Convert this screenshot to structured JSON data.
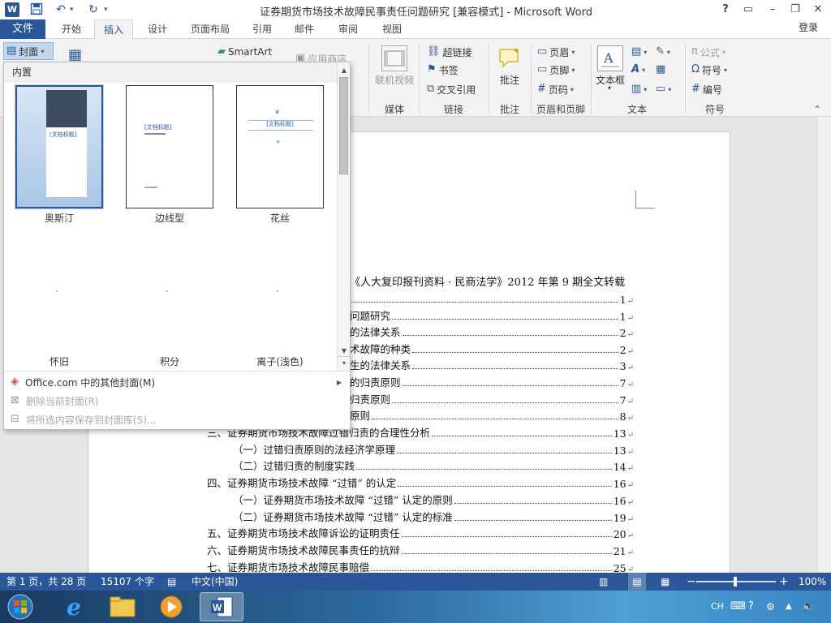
{
  "window": {
    "title": "证券期货市场技术故障民事责任问题研究 [兼容模式] - Microsoft Word",
    "help": "?",
    "controls": [
      "▭",
      "–",
      "❐",
      "✕"
    ]
  },
  "tabs": {
    "file": "文件",
    "items": [
      "开始",
      "插入",
      "设计",
      "页面布局",
      "引用",
      "邮件",
      "审阅",
      "视图"
    ],
    "active": "插入",
    "login": "登录"
  },
  "ribbon": {
    "cover_btn": "封面",
    "smartart": "SmartArt",
    "app_store": "应用商店",
    "online_video": "联机视频",
    "media_group": "媒体",
    "hyperlink": "超链接",
    "bookmark": "书签",
    "cross_ref": "交叉引用",
    "links_group": "链接",
    "comment": "批注",
    "comment_group": "批注",
    "header": "页眉",
    "footer": "页脚",
    "page_number": "页码",
    "hf_group": "页眉和页脚",
    "textbox": "文本框",
    "text_group": "文本",
    "formula": "公式",
    "symbol": "符号",
    "numbering": "编号",
    "symbol_group": "符号"
  },
  "gallery": {
    "header": "内置",
    "covers": [
      {
        "name": "奥斯汀",
        "title": "[文档标题]"
      },
      {
        "name": "边线型",
        "title": "[文档标题]"
      },
      {
        "name": "花丝",
        "title": "[文档标题]"
      },
      {
        "name": "怀旧"
      },
      {
        "name": "积分"
      },
      {
        "name": "离子(浅色)"
      }
    ],
    "menu": [
      {
        "label": "Office.com 中的其他封面(M)"
      },
      {
        "label": "删除当前封面(R)"
      },
      {
        "label": "将所选内容保存到封面库(S)..."
      }
    ]
  },
  "document": {
    "heading": "《人大复印报刊资料 · 民商法学》2012 年第 9 期全文转载",
    "toc": [
      {
        "text": "",
        "page": "1"
      },
      {
        "text": "问题研究",
        "page": "1"
      },
      {
        "text": "的法律关系",
        "page": "2"
      },
      {
        "text": "术故障的种类",
        "page": "2"
      },
      {
        "text": "生的法律关系",
        "page": "3"
      },
      {
        "text": "的归责原则",
        "page": "7"
      },
      {
        "text": "归责原则",
        "page": "7"
      },
      {
        "text": "原则",
        "page": "8"
      },
      {
        "text": "三、证券期货市场技术故障过错归责的合理性分析",
        "page": "13"
      },
      {
        "text": "（一）过错归责原则的法经济学原理",
        "page": "13"
      },
      {
        "text": "（二）过错归责的制度实践",
        "page": "14"
      },
      {
        "text": "四、证券期货市场技术故障 “过错” 的认定",
        "page": "16"
      },
      {
        "text": "（一）证券期货市场技术故障 “过错” 认定的原则",
        "page": "16"
      },
      {
        "text": "（二）证券期货市场技术故障 “过错” 认定的标准",
        "page": "19"
      },
      {
        "text": "五、证券期货市场技术故障诉讼的证明责任",
        "page": "20"
      },
      {
        "text": "六、证券期货市场技术故障民事责任的抗辩",
        "page": "21"
      },
      {
        "text": "七、证券期货市场技术故障民事赔偿",
        "page": "25"
      }
    ],
    "para_mark": "↵"
  },
  "status": {
    "page": "第 1 页，共 28 页",
    "words": "15107 个字",
    "lang": "中文(中国)",
    "zoom": "100%",
    "zoom_minus": "−",
    "zoom_plus": "+"
  },
  "tray": {
    "ime": "CH"
  },
  "colors": {
    "accent": "#2b579a"
  }
}
